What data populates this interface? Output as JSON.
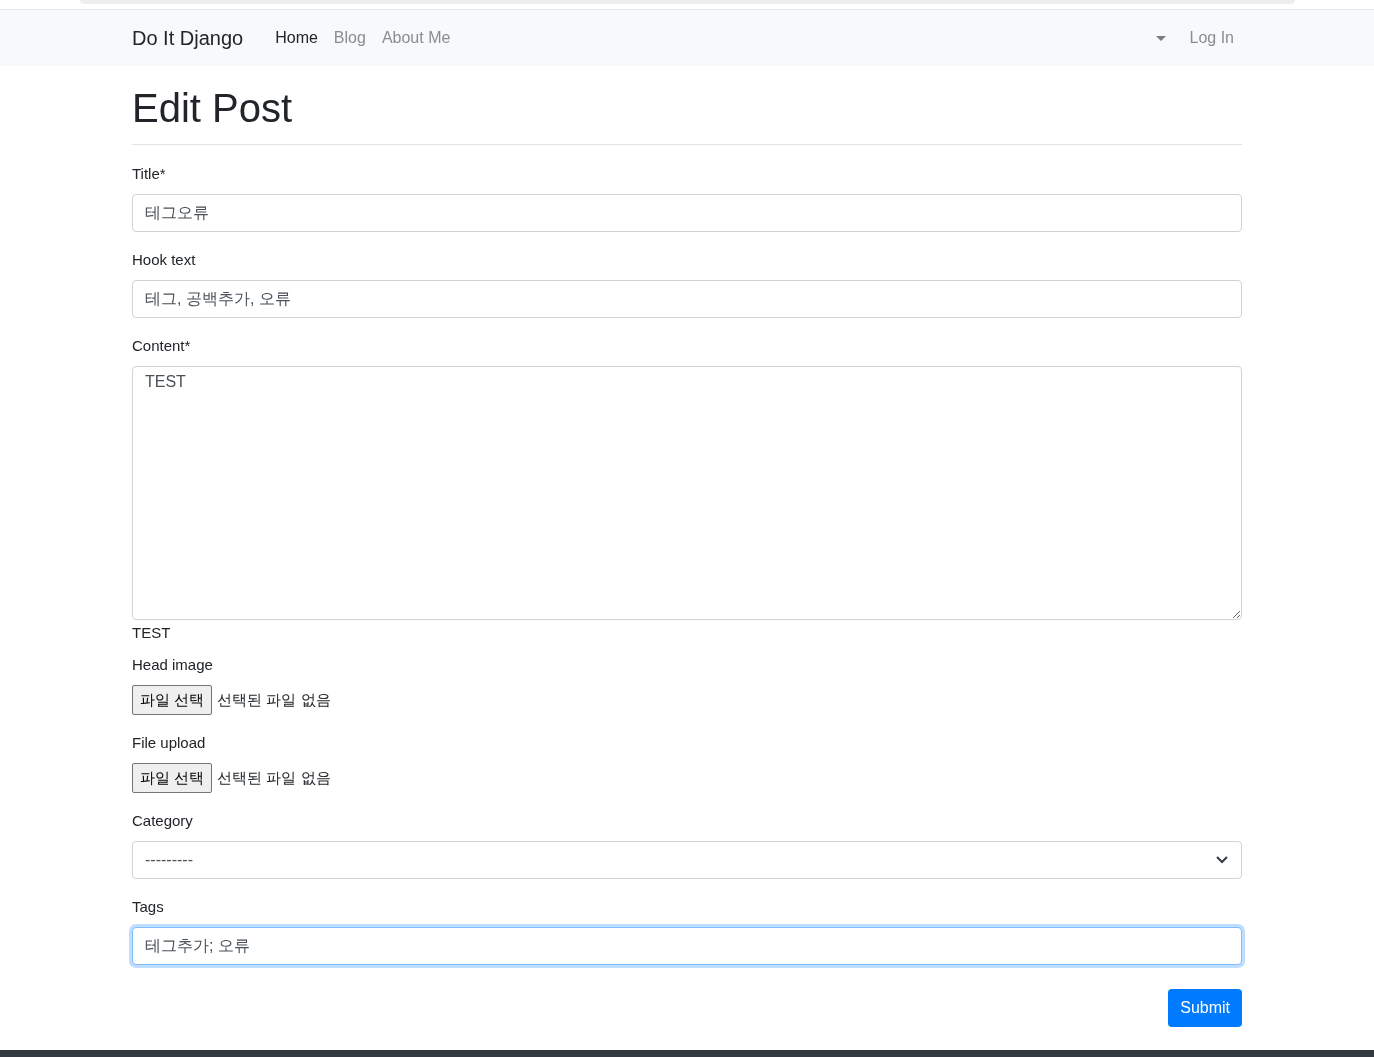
{
  "navbar": {
    "brand": "Do It Django",
    "items": [
      {
        "label": "Home",
        "selected": true
      },
      {
        "label": "Blog",
        "selected": false
      },
      {
        "label": "About Me",
        "selected": false
      }
    ],
    "login": "Log In"
  },
  "heading": "Edit Post",
  "fields": [
    {
      "kind": "text",
      "label": "Title*",
      "value": "테그오류",
      "focused": false
    },
    {
      "kind": "text",
      "label": "Hook text",
      "value": "테그, 공백추가, 오류",
      "focused": false
    },
    {
      "kind": "textarea",
      "label": "Content*",
      "value": "TEST",
      "help": "TEST",
      "focused": false
    },
    {
      "kind": "file",
      "label": "Head image",
      "button": "파일 선택",
      "status": "선택된 파일 없음"
    },
    {
      "kind": "file",
      "label": "File upload",
      "button": "파일 선택",
      "status": "선택된 파일 없음"
    },
    {
      "kind": "select",
      "label": "Category",
      "value": "---------",
      "focused": false
    },
    {
      "kind": "text",
      "label": "Tags",
      "value": "테그추가; 오류",
      "focused": true
    }
  ],
  "submit": "Submit"
}
